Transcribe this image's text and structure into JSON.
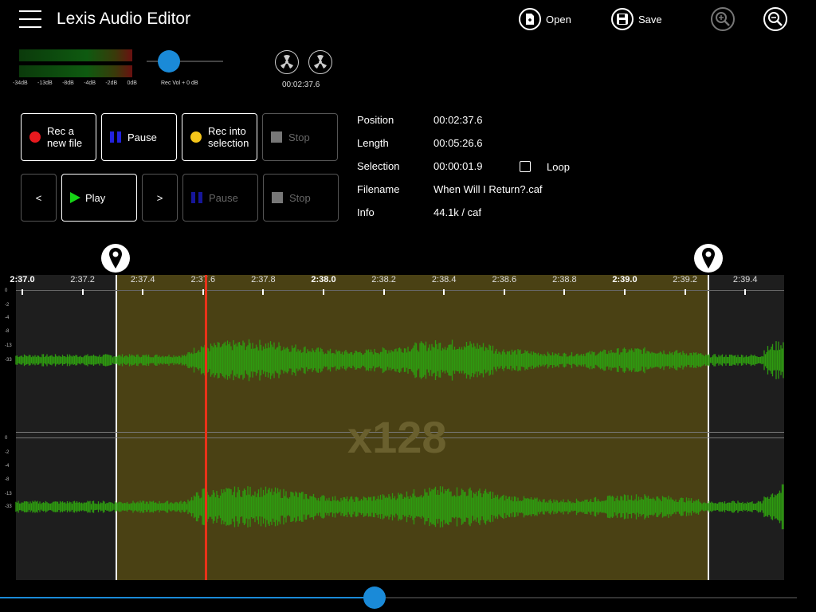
{
  "app": {
    "title": "Lexis Audio Editor"
  },
  "toolbar": {
    "open_label": "Open",
    "save_label": "Save"
  },
  "meter": {
    "scale": [
      "-34dB",
      "-13dB",
      "-8dB",
      "-4dB",
      "-2dB",
      "0dB"
    ],
    "rec_volume_label": "Rec Vol + 0 dB",
    "rec_volume_level": 0.15
  },
  "clock": {
    "time": "00:02:37.6"
  },
  "record_row": {
    "rec_new": "Rec a new file",
    "pause": "Pause",
    "rec_selection": "Rec into selection",
    "stop": "Stop"
  },
  "play_row": {
    "prev": "<",
    "play": "Play",
    "next": ">",
    "pause": "Pause",
    "stop": "Stop"
  },
  "info": {
    "position_label": "Position",
    "position": "00:02:37.6",
    "length_label": "Length",
    "length": "00:05:26.6",
    "selection_label": "Selection",
    "selection": "00:00:01.9",
    "loop_label": "Loop",
    "loop_checked": false,
    "filename_label": "Filename",
    "filename": "When Will I Return?.caf",
    "info_label": "Info",
    "info": "44.1k / caf"
  },
  "waveform": {
    "ruler": [
      "2:37.0",
      "2:37.2",
      "2:37.4",
      "2:37.6",
      "2:37.8",
      "2:38.0",
      "2:38.2",
      "2:38.4",
      "2:38.6",
      "2:38.8",
      "2:39.0",
      "2:39.2",
      "2:39.4"
    ],
    "bold_labels": [
      "2:37.0",
      "2:38.0",
      "2:39.0"
    ],
    "db_scale": [
      "0",
      "-2",
      "-4",
      "-8",
      "-13",
      "-33"
    ],
    "zoom_label": "x128",
    "colors": {
      "wave": "#2e9a10",
      "selection": "#4a4114",
      "playhead": "#e8321a",
      "unselected": "#1e1e1e"
    }
  },
  "scroll": {
    "level": 0.47
  }
}
